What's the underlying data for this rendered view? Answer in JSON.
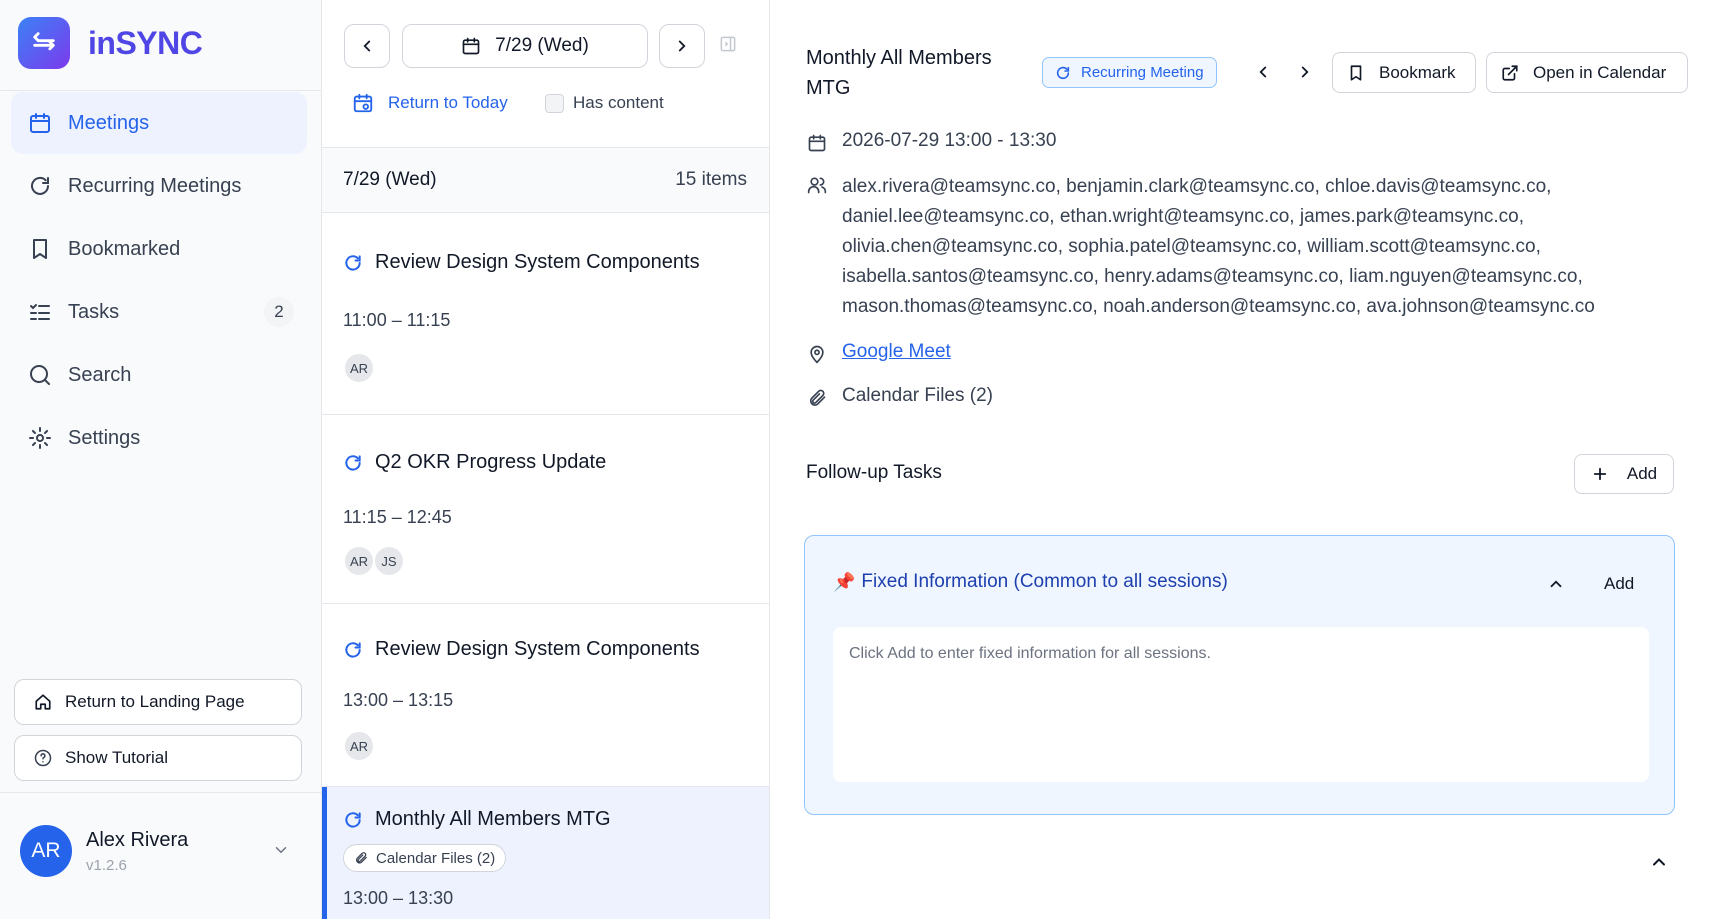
{
  "app": {
    "name": "inSYNC"
  },
  "sidebar": {
    "items": [
      {
        "label": "Meetings",
        "active": true
      },
      {
        "label": "Recurring Meetings"
      },
      {
        "label": "Bookmarked"
      },
      {
        "label": "Tasks",
        "badge": "2"
      },
      {
        "label": "Search"
      },
      {
        "label": "Settings"
      }
    ],
    "return_landing": "Return to Landing Page",
    "show_tutorial": "Show Tutorial",
    "user": {
      "initials": "AR",
      "name": "Alex Rivera",
      "version": "v1.2.6"
    }
  },
  "list": {
    "date_label": "7/29 (Wed)",
    "return_today": "Return to Today",
    "has_content": "Has content",
    "header": {
      "date": "7/29 (Wed)",
      "count": "15 items"
    },
    "meetings": [
      {
        "title": "Review Design System Components",
        "time": "11:00 – 11:15",
        "attendees": [
          "AR"
        ]
      },
      {
        "title": "Q2 OKR Progress Update",
        "time": "11:15 – 12:45",
        "attendees": [
          "AR",
          "JS"
        ]
      },
      {
        "title": "Review Design System Components",
        "time": "13:00 – 13:15",
        "attendees": [
          "AR"
        ]
      },
      {
        "title": "Monthly All Members MTG",
        "time": "13:00 – 13:30",
        "files": "Calendar Files (2)",
        "selected": true
      }
    ]
  },
  "detail": {
    "title": "Monthly All Members MTG",
    "recurring_badge": "Recurring Meeting",
    "bookmark_label": "Bookmark",
    "open_calendar_label": "Open in Calendar",
    "datetime": "2026-07-29 13:00 - 13:30",
    "attendees": "alex.rivera@teamsync.co, benjamin.clark@teamsync.co, chloe.davis@teamsync.co, daniel.lee@teamsync.co, ethan.wright@teamsync.co, james.park@teamsync.co, olivia.chen@teamsync.co, sophia.patel@teamsync.co, william.scott@teamsync.co, isabella.santos@teamsync.co, henry.adams@teamsync.co, liam.nguyen@teamsync.co, mason.thomas@teamsync.co, noah.anderson@teamsync.co, ava.johnson@teamsync.co",
    "location": "Google Meet",
    "files": "Calendar Files (2)",
    "followup_title": "Follow-up Tasks",
    "followup_add": "Add",
    "fixed": {
      "pin": "📌",
      "title": "Fixed Information (Common to all sessions)",
      "add_label": "Add",
      "placeholder": "Click Add to enter fixed information for all sessions."
    }
  },
  "colors": {
    "accent": "#2563eb",
    "brand": "#4f46e5",
    "selected_bg": "#eef2ff",
    "info_bg": "#eff6ff",
    "info_border": "#93c5fd"
  },
  "icons": [
    "swap-arrows-icon",
    "calendar-icon",
    "refresh-icon",
    "bookmark-icon",
    "task-list-icon",
    "search-icon",
    "gear-icon",
    "home-icon",
    "help-circle-icon",
    "chevron-down-icon",
    "chevron-left-icon",
    "chevron-right-icon",
    "panel-icon",
    "calendar-today-icon",
    "users-icon",
    "map-pin-icon",
    "paperclip-icon",
    "external-link-icon",
    "plus-icon",
    "chevron-up-icon",
    "pin-icon"
  ]
}
